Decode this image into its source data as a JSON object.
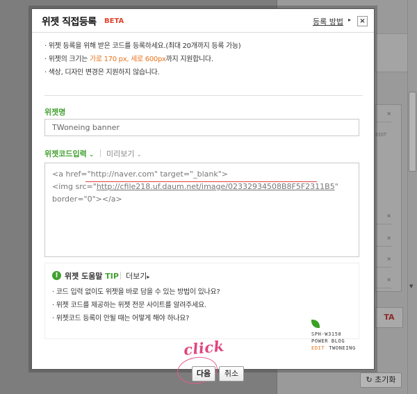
{
  "background": {
    "edit_label": "EDIT",
    "list_items": [
      "×",
      "×",
      "×",
      "×",
      "×"
    ],
    "button_label": "TA",
    "reset_label": "초기화"
  },
  "dialog": {
    "title": "위젯 직접등록",
    "badge": "BETA",
    "help_link": "등록 방법",
    "close_label": "×",
    "notice": {
      "line1": "위젯 등록을 위해 받은 코드를 등록하세요.(최대 20개까지 등록 가능)",
      "line2_pre": "위젯의 크기는 ",
      "line2_hl": "가로 170 px, 세로 600px",
      "line2_post": "까지 지원합니다.",
      "line3": "색상, 디자인 변경은 지원하지 않습니다."
    },
    "name_label": "위젯명",
    "name_value": "TWoneing banner",
    "tabs": {
      "code": "위젯코드입력",
      "preview": "미리보기"
    },
    "code": {
      "line1": "<a href=\"http://naver.com\" target=\"_blank\">",
      "line2_pre": "<img src=\"",
      "line2_url": "http://cfile218.uf.daum.net/image/02332934508B8F5F2311B5",
      "line2_post": "\"",
      "line3": "border=\"0\"></a>"
    },
    "tip": {
      "icon": "!",
      "title_pre": "위젯 도움말 ",
      "title_tip": "TIP",
      "more": "더보기",
      "items": [
        "코드 입력 없이도 위젯을 바로 담을 수 있는 방법이 있나요?",
        "위젯 코드를 제공하는 위젯 전문 사이트를 알려주세요.",
        "위젯코드 등록이 안될 때는 어떻게 해야 하나요?"
      ]
    },
    "brand": {
      "line1": "SPH-W3150",
      "line2": "POWER BLOG",
      "line3_edit": "EDIT",
      "line3_name": "TWONEING"
    },
    "buttons": {
      "next": "다음",
      "cancel": "취소"
    },
    "annotation": "click"
  },
  "colors": {
    "accent_green": "#41a12f",
    "highlight_orange": "#e8721c",
    "badge_red": "#e0432c",
    "annotation_pink": "#e0457d"
  }
}
